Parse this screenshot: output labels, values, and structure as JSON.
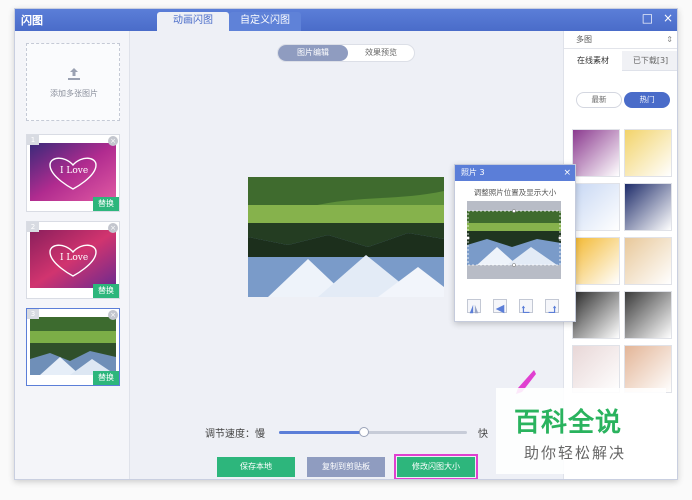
{
  "window": {
    "app_title": "闪图",
    "tabs": [
      "动画闪图",
      "自定义闪图"
    ],
    "controls": [
      "□",
      "×"
    ]
  },
  "left_panel": {
    "add_label": "添加多张图片",
    "thumbs": [
      {
        "num": "1",
        "replace": "替换"
      },
      {
        "num": "2",
        "replace": "替换"
      },
      {
        "num": "3",
        "replace": "替换"
      }
    ]
  },
  "center": {
    "seg_edit": "图片编辑",
    "seg_preview": "效果预览",
    "speed_label": "调节速度：慢",
    "speed_fast": "快",
    "speed_value": 0.45,
    "btn_save": "保存本地",
    "btn_copy": "复制到剪贴板",
    "btn_resize": "修改闪图大小"
  },
  "dialog": {
    "title": "照片 3",
    "close": "×",
    "tip": "调整照片位置及显示大小"
  },
  "right_panel": {
    "select_value": "多图",
    "select_arrow": "⇕",
    "tab_online": "在线素材",
    "tab_downloaded": "已下载[3]",
    "pill_new": "最新",
    "pill_hot": "热门",
    "grid_colors": [
      "#8b3a8f",
      "#f2d36a",
      "#c7d7f3",
      "#1e2c6a",
      "#f3b830",
      "#e8c89a",
      "#2b2b2b",
      "#3a3a3a",
      "#e8d7d7",
      "#e3b597"
    ]
  },
  "watermark": {
    "title": "百科全说",
    "sub": "助你轻松解决"
  }
}
